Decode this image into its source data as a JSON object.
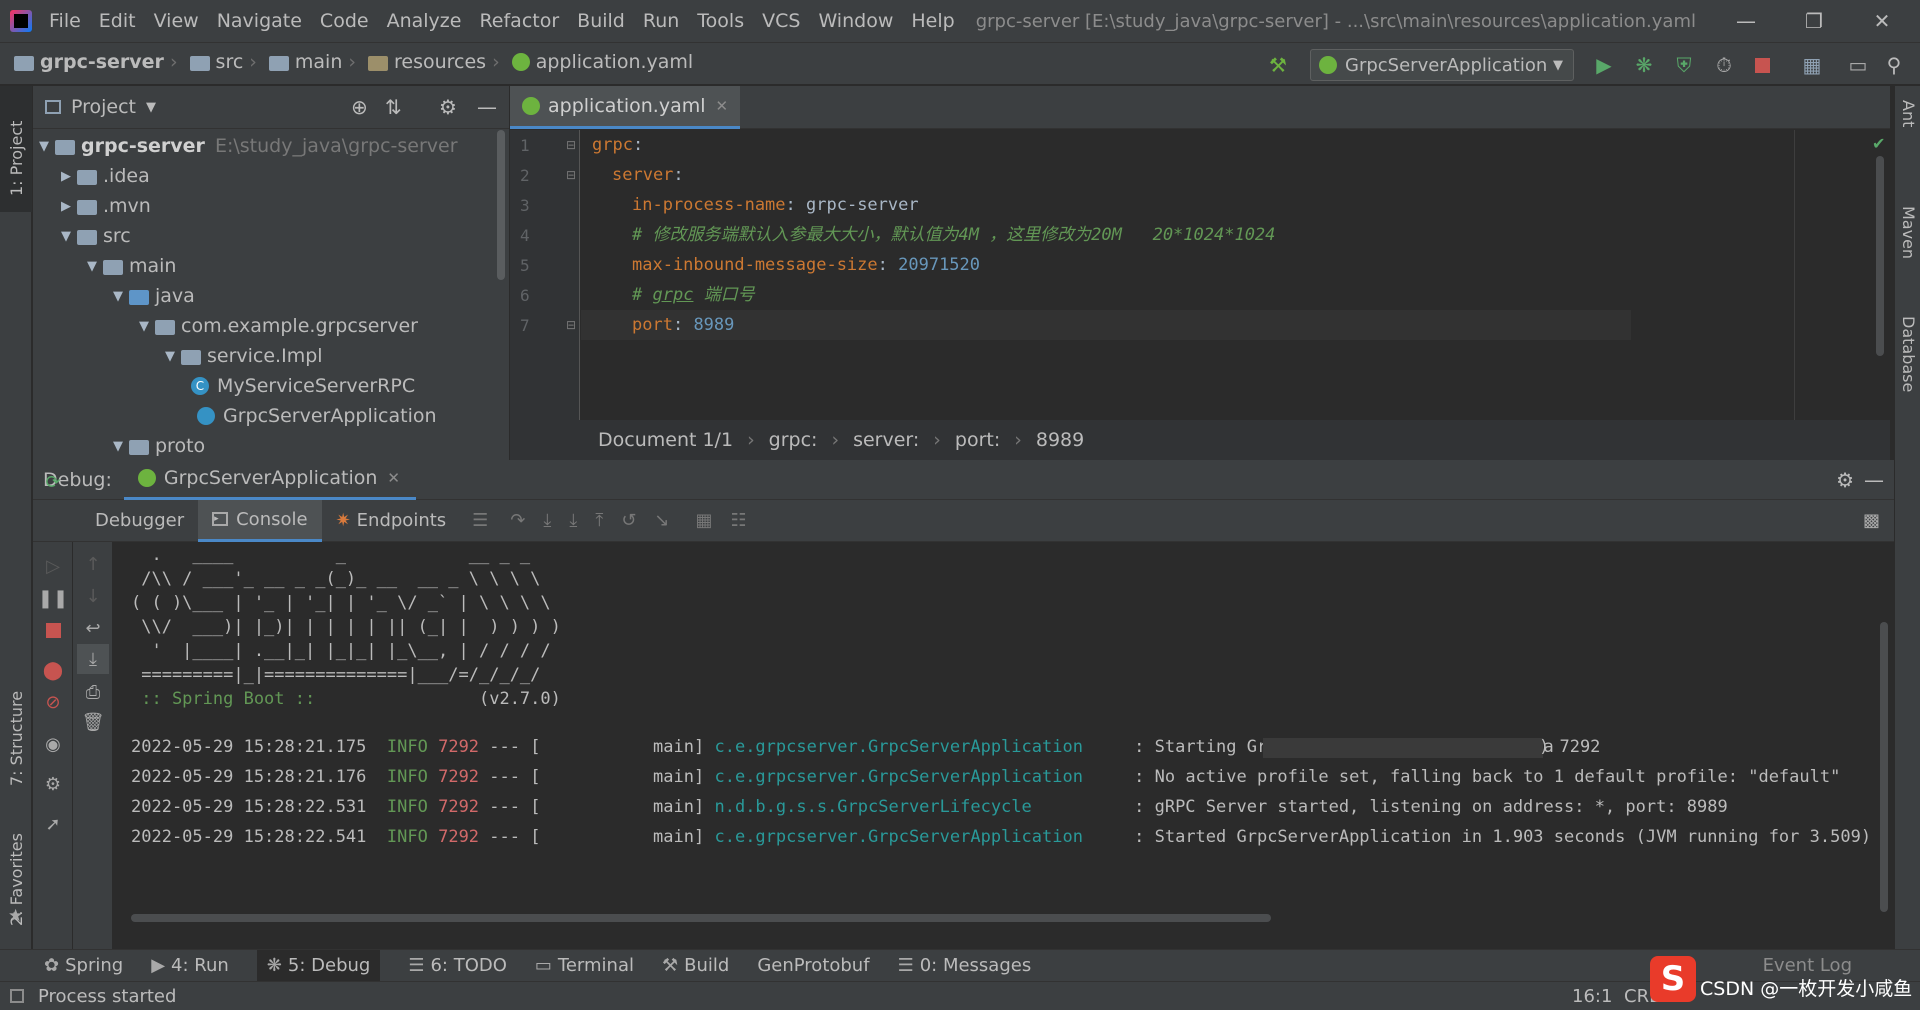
{
  "menu": {
    "items": [
      "File",
      "Edit",
      "View",
      "Navigate",
      "Code",
      "Analyze",
      "Refactor",
      "Build",
      "Run",
      "Tools",
      "VCS",
      "Window",
      "Help"
    ],
    "window_title": "grpc-server [E:\\study_java\\grpc-server] - ...\\src\\main\\resources\\application.yaml"
  },
  "breadcrumb": [
    "grpc-server",
    "src",
    "main",
    "resources",
    "application.yaml"
  ],
  "run_config": "GrpcServerApplication",
  "project_panel": {
    "title": "Project",
    "tree": [
      {
        "label": "grpc-server",
        "hint": "E:\\study_java\\grpc-server"
      },
      {
        "label": ".idea"
      },
      {
        "label": ".mvn"
      },
      {
        "label": "src"
      },
      {
        "label": "main"
      },
      {
        "label": "java"
      },
      {
        "label": "com.example.grpcserver"
      },
      {
        "label": "service.Impl"
      },
      {
        "label": "MyServiceServerRPC"
      },
      {
        "label": "GrpcServerApplication"
      },
      {
        "label": "proto"
      }
    ]
  },
  "editor": {
    "tab": "application.yaml",
    "line_numbers": [
      "1",
      "2",
      "3",
      "4",
      "5",
      "6",
      "7"
    ],
    "lines": {
      "l1_key": "grpc",
      "l2_key": "server",
      "l3_key": "in-process-name",
      "l3_val": "grpc-server",
      "l4_comment": "# 修改服务端默认入参最大大小，默认值为4M ，这里修改为20M   20*1024*1024",
      "l5_key": "max-inbound-message-size",
      "l5_val": "20971520",
      "l6_comment_hash": "# ",
      "l6_comment_word": "grpc",
      "l6_comment_rest": " 端口号",
      "l7_key": "port",
      "l7_val": "8989"
    },
    "status": [
      "Document 1/1",
      "grpc:",
      "server:",
      "port:",
      "8989"
    ]
  },
  "debug": {
    "label": "Debug:",
    "config": "GrpcServerApplication",
    "tabs": [
      "Debugger",
      "Console",
      "Endpoints"
    ],
    "banner": [
      "  .   ____          _            __ _ _",
      " /\\\\ / ___'_ __ _ _(_)_ __  __ _ \\ \\ \\ \\",
      "( ( )\\___ | '_ | '_| | '_ \\/ _` | \\ \\ \\ \\",
      " \\\\/  ___)| |_)| | | | | || (_| |  ) ) ) )",
      "  '  |____| .__|_| |_|_| |_\\__, | / / / /",
      " =========|_|==============|___/=/_/_/_/"
    ],
    "spring_label": " :: Spring Boot :: ",
    "spring_version": "               (v2.7.0)",
    "logs": [
      {
        "ts": "2022-05-29 15:28:21.175",
        "level": "INFO",
        "pid": "7292",
        "sep": "--- [           main]",
        "logger": "c.e.grpcserver.GrpcServerApplication",
        "msg": ": Starting GrpcServerApplication using Ja"
      },
      {
        "ts": "2022-05-29 15:28:21.176",
        "level": "INFO",
        "pid": "7292",
        "sep": "--- [           main]",
        "logger": "c.e.grpcserver.GrpcServerApplication",
        "msg": ": No active profile set, falling back to 1 default profile: \"default\""
      },
      {
        "ts": "2022-05-29 15:28:22.531",
        "level": "INFO",
        "pid": "7292",
        "sep": "--- [           main]",
        "logger": "n.d.b.g.s.s.GrpcServerLifecycle",
        "msg": ": gRPC Server started, listening on address: *, port: 8989"
      },
      {
        "ts": "2022-05-29 15:28:22.541",
        "level": "INFO",
        "pid": "7292",
        "sep": "--- [           main]",
        "logger": "c.e.grpcserver.GrpcServerApplication",
        "msg": ": Started GrpcServerApplication in 1.903 seconds (JVM running for 3.509)"
      }
    ],
    "log0_tail": ") 7292"
  },
  "side_tabs": {
    "left_top": "1: Project",
    "left_structure": "7: Structure",
    "left_favorites": "2: Favorites",
    "right": [
      "Ant",
      "Maven",
      "Database"
    ]
  },
  "bottom_tabs": [
    "Spring",
    "4: Run",
    "5: Debug",
    "6: TODO",
    "Terminal",
    "Build",
    "GenProtobuf",
    "0: Messages"
  ],
  "event_log": "Event Log",
  "status": {
    "message": "Process started",
    "position": "16:1",
    "line_sep": "CRLF",
    "watermark": "CSDN @一枚开发小咸鱼"
  }
}
